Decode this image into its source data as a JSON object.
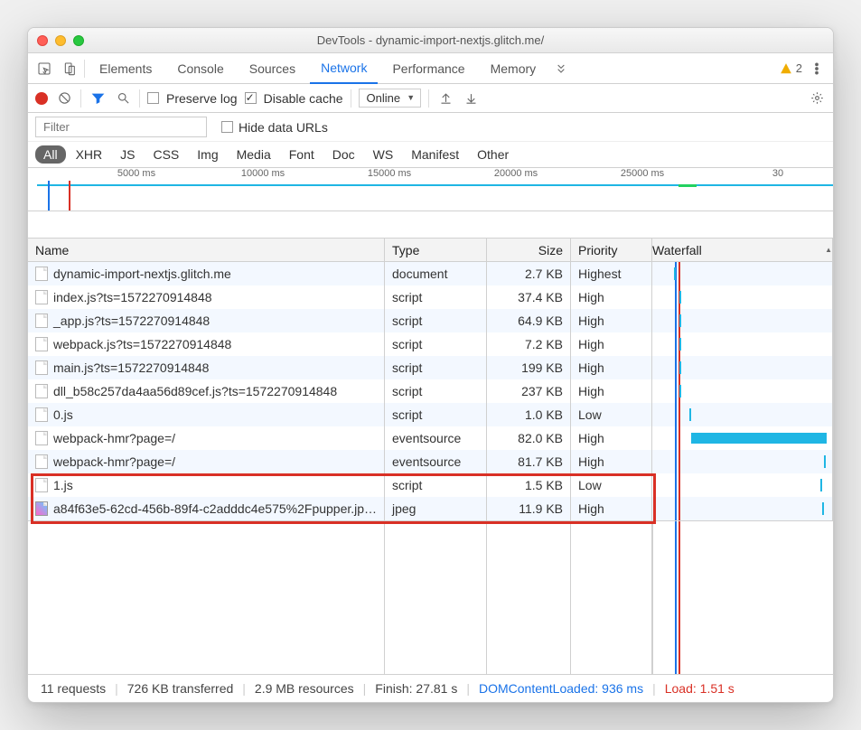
{
  "title": "DevTools - dynamic-import-nextjs.glitch.me/",
  "tabs": [
    "Elements",
    "Console",
    "Sources",
    "Network",
    "Performance",
    "Memory"
  ],
  "activeTab": "Network",
  "warningCount": "2",
  "toolbar": {
    "preserve": "Preserve log",
    "disableCache": "Disable cache",
    "online": "Online"
  },
  "filter": {
    "placeholder": "Filter",
    "hide": "Hide data URLs"
  },
  "types": [
    "All",
    "XHR",
    "JS",
    "CSS",
    "Img",
    "Media",
    "Font",
    "Doc",
    "WS",
    "Manifest",
    "Other"
  ],
  "timeline": {
    "ticks": [
      "5000 ms",
      "10000 ms",
      "15000 ms",
      "20000 ms",
      "25000 ms",
      "30"
    ]
  },
  "headers": {
    "name": "Name",
    "type": "Type",
    "size": "Size",
    "priority": "Priority",
    "waterfall": "Waterfall"
  },
  "rows": [
    {
      "name": "dynamic-import-nextjs.glitch.me",
      "type": "document",
      "size": "2.7 KB",
      "priority": "Highest",
      "wf": {
        "l": 24,
        "w": 3
      }
    },
    {
      "name": "index.js?ts=1572270914848",
      "type": "script",
      "size": "37.4 KB",
      "priority": "High",
      "wf": {
        "l": 30,
        "w": 5
      }
    },
    {
      "name": "_app.js?ts=1572270914848",
      "type": "script",
      "size": "64.9 KB",
      "priority": "High",
      "wf": {
        "l": 30,
        "w": 6
      }
    },
    {
      "name": "webpack.js?ts=1572270914848",
      "type": "script",
      "size": "7.2 KB",
      "priority": "High",
      "wf": {
        "l": 30,
        "w": 5
      }
    },
    {
      "name": "main.js?ts=1572270914848",
      "type": "script",
      "size": "199 KB",
      "priority": "High",
      "wf": {
        "l": 30,
        "w": 7
      }
    },
    {
      "name": "dll_b58c257da4aa56d89cef.js?ts=1572270914848",
      "type": "script",
      "size": "237 KB",
      "priority": "High",
      "wf": {
        "l": 30,
        "w": 8
      }
    },
    {
      "name": "0.js",
      "type": "script",
      "size": "1.0 KB",
      "priority": "Low",
      "wf": {
        "l": 41,
        "w": 3
      }
    },
    {
      "name": "webpack-hmr?page=/",
      "type": "eventsource",
      "size": "82.0 KB",
      "priority": "High",
      "wf": {
        "l": 43,
        "w": 150
      }
    },
    {
      "name": "webpack-hmr?page=/",
      "type": "eventsource",
      "size": "81.7 KB",
      "priority": "High",
      "wf": {
        "l": 190,
        "w": 6
      }
    },
    {
      "name": "1.js",
      "type": "script",
      "size": "1.5 KB",
      "priority": "Low",
      "wf": {
        "l": 186,
        "w": 2
      }
    },
    {
      "name": "a84f63e5-62cd-456b-89f4-c2adddc4e575%2Fpupper.jp…",
      "type": "jpeg",
      "size": "11.9 KB",
      "priority": "High",
      "wf": {
        "l": 188,
        "w": 3
      },
      "img": true
    }
  ],
  "status": {
    "reqs": "11 requests",
    "xfer": "726 KB transferred",
    "res": "2.9 MB resources",
    "finish": "Finish: 27.81 s",
    "dcl": "DOMContentLoaded: 936 ms",
    "load": "Load: 1.51 s"
  }
}
